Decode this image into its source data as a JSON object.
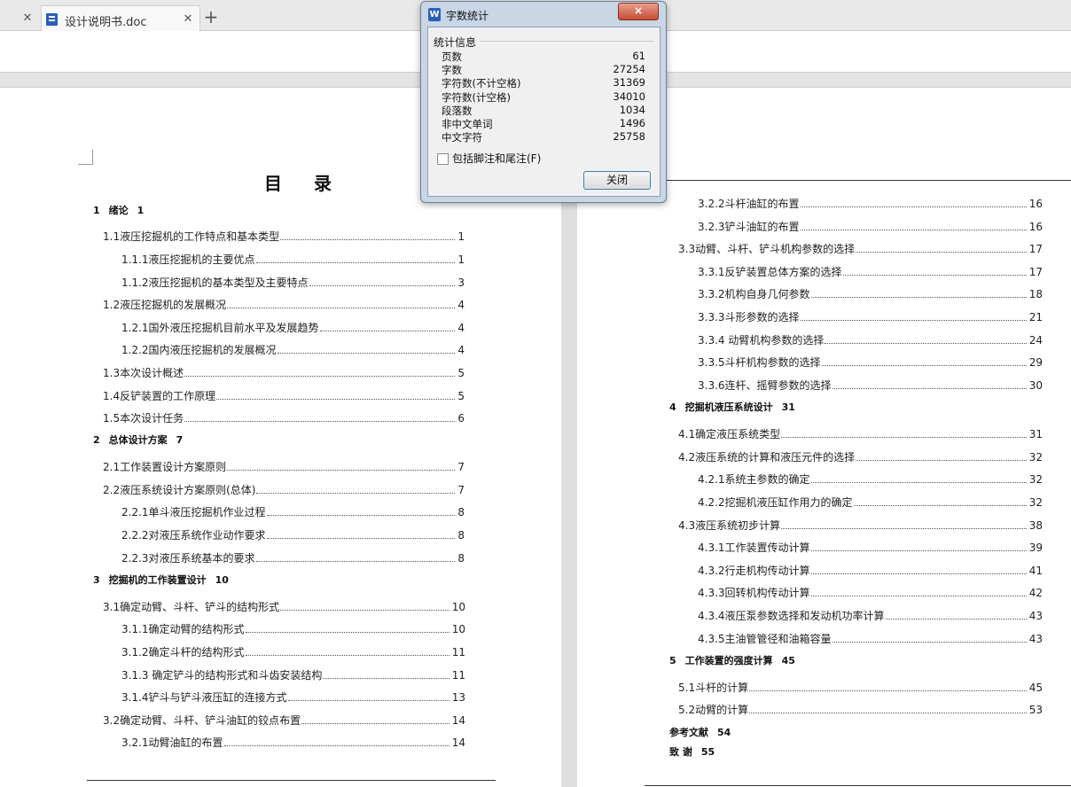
{
  "tabs": [
    {
      "label": ""
    },
    {
      "label": "设计说明书.doc"
    }
  ],
  "dialog": {
    "title": "字数统计",
    "close_x": "×",
    "group_label": "统计信息",
    "stats": [
      {
        "label": "页数",
        "value": "61"
      },
      {
        "label": "字数",
        "value": "27254"
      },
      {
        "label": "字符数(不计空格)",
        "value": "31369"
      },
      {
        "label": "字符数(计空格)",
        "value": "34010"
      },
      {
        "label": "段落数",
        "value": "1034"
      },
      {
        "label": "非中文单词",
        "value": "1496"
      },
      {
        "label": "中文字符",
        "value": "25758"
      }
    ],
    "checkbox_label": "包括脚注和尾注(F)",
    "close_button": "关闭"
  },
  "left_page": {
    "title_a": "目",
    "title_b": "录",
    "entries": [
      {
        "kind": "head",
        "num": "1",
        "text": "绪论",
        "page": "1"
      },
      {
        "kind": "line",
        "text": "1.1液压挖掘机的工作特点和基本类型",
        "page": "1"
      },
      {
        "kind": "line",
        "text": "1.1.1液压挖掘机的主要优点",
        "page": "1"
      },
      {
        "kind": "line",
        "text": "1.1.2液压挖掘机的基本类型及主要特点",
        "page": "3"
      },
      {
        "kind": "line",
        "text": "1.2液压挖掘机的发展概况",
        "page": "4"
      },
      {
        "kind": "line",
        "text": "1.2.1国外液压挖掘机目前水平及发展趋势",
        "page": "4"
      },
      {
        "kind": "line",
        "text": "1.2.2国内液压挖掘机的发展概况",
        "page": "4"
      },
      {
        "kind": "line",
        "text": "1.3本次设计概述",
        "page": "5"
      },
      {
        "kind": "line",
        "text": "1.4反铲装置的工作原理",
        "page": "5"
      },
      {
        "kind": "line",
        "text": "1.5本次设计任务",
        "page": "6"
      },
      {
        "kind": "head",
        "num": "2",
        "text": "总体设计方案",
        "page": "7"
      },
      {
        "kind": "line",
        "text": "2.1工作装置设计方案原则",
        "page": "7"
      },
      {
        "kind": "line",
        "text": "2.2液压系统设计方案原则(总体)",
        "page": "7"
      },
      {
        "kind": "line",
        "text": "2.2.1单斗液压挖掘机作业过程",
        "page": "8"
      },
      {
        "kind": "line",
        "text": "2.2.2对液压系统作业动作要求",
        "page": "8"
      },
      {
        "kind": "line",
        "text": "2.2.3对液压系统基本的要求",
        "page": "8"
      },
      {
        "kind": "head",
        "num": "3",
        "text": "挖掘机的工作装置设计",
        "page": "10"
      },
      {
        "kind": "line",
        "text": "3.1确定动臂、斗杆、铲斗的结构形式",
        "page": "10"
      },
      {
        "kind": "line",
        "text": "3.1.1确定动臂的结构形式",
        "page": "10"
      },
      {
        "kind": "line",
        "text": "3.1.2确定斗杆的结构形式",
        "page": "11"
      },
      {
        "kind": "line",
        "text": "3.1.3 确定铲斗的结构形式和斗齿安装结构",
        "page": "11"
      },
      {
        "kind": "line",
        "text": "3.1.4铲斗与铲斗液压缸的连接方式",
        "page": "13"
      },
      {
        "kind": "line",
        "text": "3.2确定动臂、斗杆、铲斗油缸的铰点布置",
        "page": "14"
      },
      {
        "kind": "line",
        "text": "3.2.1动臂油缸的布置",
        "page": "14"
      }
    ]
  },
  "right_page": {
    "entries": [
      {
        "kind": "line",
        "text": "3.2.2斗杆油缸的布置",
        "page": "16"
      },
      {
        "kind": "line",
        "text": "3.2.3铲斗油缸的布置",
        "page": "16"
      },
      {
        "kind": "line",
        "text": "3.3动臂、斗杆、铲斗机构参数的选择",
        "page": "17"
      },
      {
        "kind": "line",
        "text": "3.3.1反铲装置总体方案的选择",
        "page": "17"
      },
      {
        "kind": "line",
        "text": "3.3.2机构自身几何参数",
        "page": "18"
      },
      {
        "kind": "line",
        "text": "3.3.3斗形参数的选择",
        "page": "21"
      },
      {
        "kind": "line",
        "text": "3.3.4 动臂机构参数的选择",
        "page": "24"
      },
      {
        "kind": "line",
        "text": "3.3.5斗杆机构参数的选择",
        "page": "29"
      },
      {
        "kind": "line",
        "text": "3.3.6连杆、摇臂参数的选择",
        "page": "30"
      },
      {
        "kind": "head",
        "num": "4",
        "text": "挖掘机液压系统设计",
        "page": "31"
      },
      {
        "kind": "line",
        "text": "4.1确定液压系统类型",
        "page": "31"
      },
      {
        "kind": "line",
        "text": "4.2液压系统的计算和液压元件的选择",
        "page": "32"
      },
      {
        "kind": "line",
        "text": "4.2.1系统主参数的确定",
        "page": "32"
      },
      {
        "kind": "line",
        "text": "4.2.2挖掘机液压缸作用力的确定",
        "page": "32"
      },
      {
        "kind": "line",
        "text": "4.3液压系统初步计算",
        "page": "38"
      },
      {
        "kind": "line",
        "text": "4.3.1工作装置传动计算",
        "page": "39"
      },
      {
        "kind": "line",
        "text": "4.3.2行走机构传动计算",
        "page": "41"
      },
      {
        "kind": "line",
        "text": "4.3.3回转机构传动计算",
        "page": "42"
      },
      {
        "kind": "line",
        "text": "4.3.4液压泵参数选择和发动机功率计算",
        "page": "43"
      },
      {
        "kind": "line",
        "text": "4.3.5主油管管径和油箱容量",
        "page": "43"
      },
      {
        "kind": "head",
        "num": "5",
        "text": "工作装置的强度计算",
        "page": "45"
      },
      {
        "kind": "line",
        "text": "5.1斗杆的计算",
        "page": "45"
      },
      {
        "kind": "line",
        "text": "5.2动臂的计算",
        "page": "53"
      },
      {
        "kind": "head",
        "num": "",
        "text": "参考文献",
        "page": "54"
      },
      {
        "kind": "head",
        "num": "",
        "text": "致  谢",
        "page": "55"
      }
    ]
  }
}
